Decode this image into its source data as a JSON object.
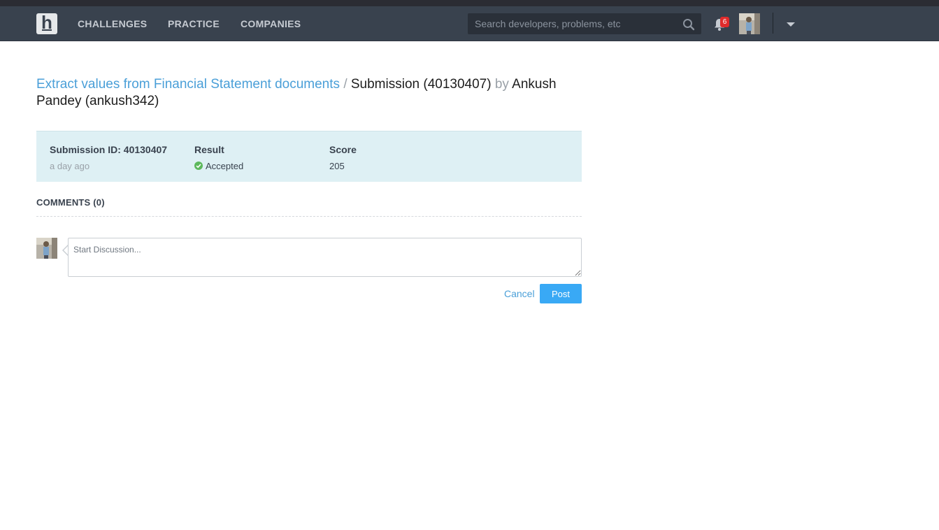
{
  "nav": {
    "logo_letter": "h",
    "links": [
      "CHALLENGES",
      "PRACTICE",
      "COMPANIES"
    ],
    "search_placeholder": "Search developers, problems, etc",
    "notification_count": "6"
  },
  "title": {
    "challenge": "Extract values from Financial Statement documents",
    "separator": "/",
    "submission": "Submission (40130407)",
    "by": "by",
    "author": "Ankush Pandey (ankush342)"
  },
  "summary": {
    "id_label": "Submission ID: 40130407",
    "time": "a day ago",
    "result_label": "Result",
    "result_value": "Accepted",
    "score_label": "Score",
    "score_value": "205"
  },
  "comments": {
    "heading": "COMMENTS (0)",
    "placeholder": "Start Discussion...",
    "cancel": "Cancel",
    "post": "Post"
  },
  "colors": {
    "navbar": "#39424e",
    "link": "#4a9fd8",
    "summary_bg": "#def0f4",
    "accepted": "#5cb85c",
    "post_button": "#39a9f5",
    "badge": "#e02b2b"
  }
}
